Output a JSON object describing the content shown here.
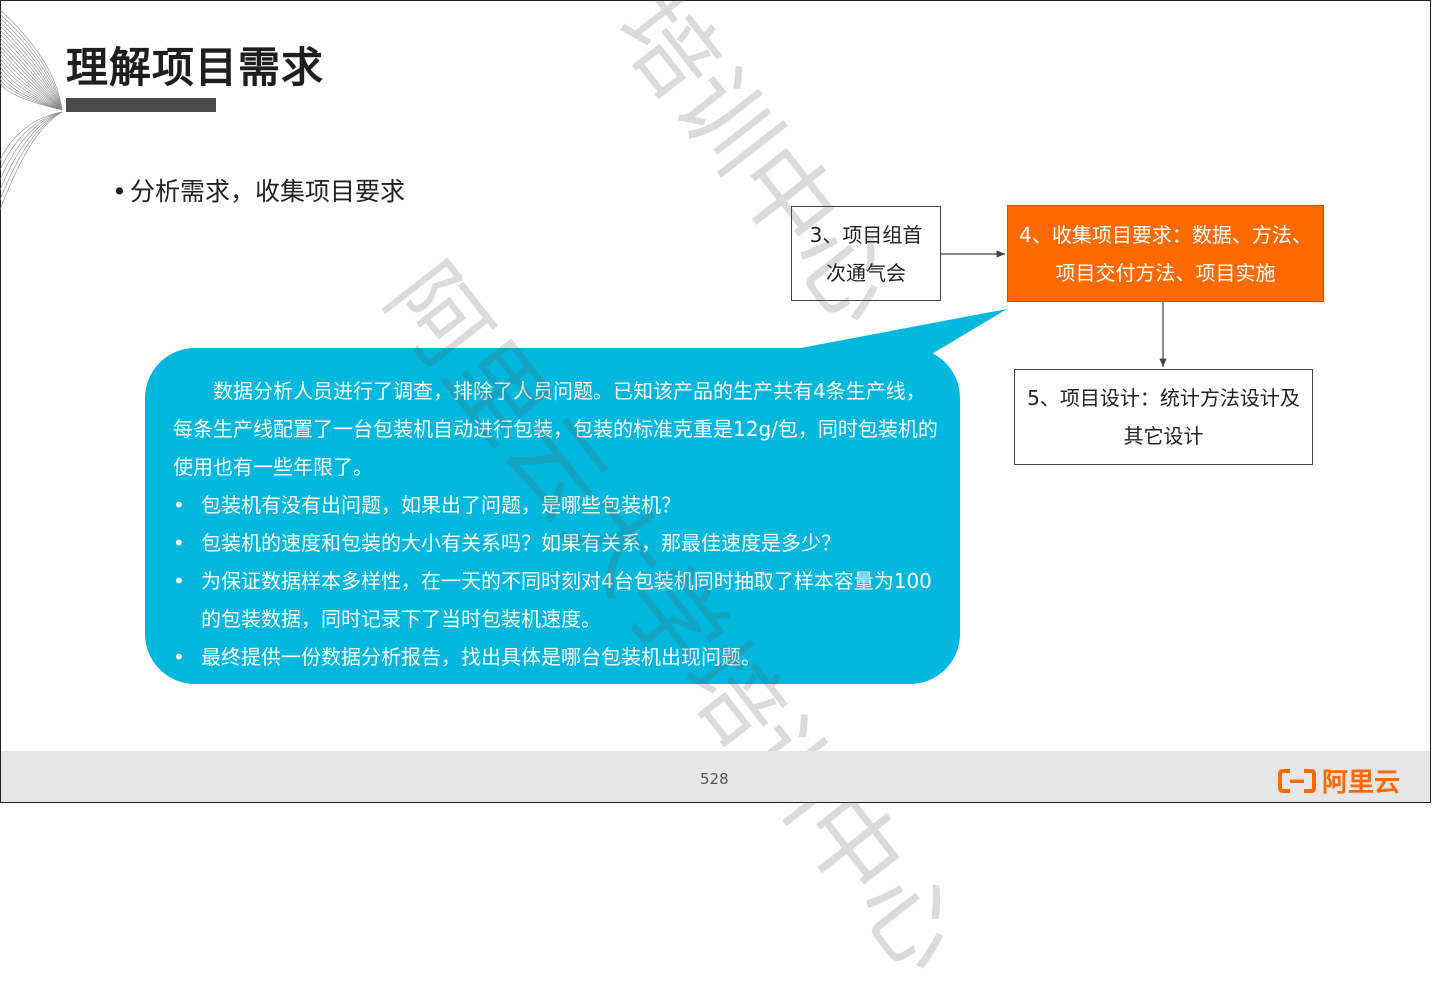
{
  "slide": {
    "title": "理解项目需求",
    "bullet": "分析需求，收集项目要求",
    "bullet_marker": "•",
    "page_number": "528"
  },
  "flow": {
    "box3": {
      "line1": "3、项目组首",
      "line2": "次通气会"
    },
    "box4": {
      "line1": "4、收集项目要求：数据、方法、",
      "line2": "项目交付方法、项目实施"
    },
    "box5": {
      "line1": "5、项目设计：统计方法设计及",
      "line2": "其它设计"
    }
  },
  "callout": {
    "paragraph": "数据分析人员进行了调查，排除了人员问题。已知该产品的生产共有4条生产线，每条生产线配置了一台包装机自动进行包装，包装的标准克重是12g/包，同时包装机的使用也有一些年限了。",
    "items": [
      "包装机有没有出问题，如果出了问题，是哪些包装机？",
      "包装机的速度和包装的大小有关系吗？如果有关系，那最佳速度是多少？",
      "为保证数据样本多样性，在一天的不同时刻对4台包装机同时抽取了样本容量为100的包装数据，同时记录下了当时包装机速度。",
      "最终提供一份数据分析报告，找出具体是哪台包装机出现问题。"
    ],
    "item_marker": "•"
  },
  "watermark": {
    "text1": "培训中心",
    "text2": "阿里云大学培训中心"
  },
  "logo": {
    "text": "阿里云"
  },
  "colors": {
    "accent": "#ff6a00",
    "callout": "#00b8de",
    "title_bar": "#4a4a4a",
    "footer": "#e6e6e6"
  }
}
